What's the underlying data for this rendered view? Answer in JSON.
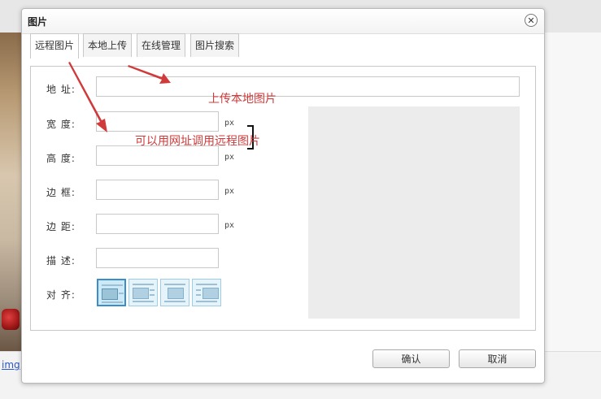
{
  "background": {
    "link_text": "img"
  },
  "dialog": {
    "title": "图片",
    "close_glyph": "✕",
    "tabs": [
      {
        "label": "远程图片",
        "active": true
      },
      {
        "label": "本地上传",
        "active": false
      },
      {
        "label": "在线管理",
        "active": false
      },
      {
        "label": "图片搜索",
        "active": false
      }
    ],
    "fields": {
      "address": {
        "label": "地 址:",
        "value": ""
      },
      "width": {
        "label": "宽 度:",
        "value": "",
        "unit": "px"
      },
      "height": {
        "label": "高 度:",
        "value": "",
        "unit": "px"
      },
      "border": {
        "label": "边 框:",
        "value": "",
        "unit": "px"
      },
      "margin": {
        "label": "边 距:",
        "value": "",
        "unit": "px"
      },
      "description": {
        "label": "描 述:",
        "value": ""
      },
      "align": {
        "label": "对 齐:",
        "options": [
          "none",
          "left",
          "center",
          "right"
        ],
        "selected": "none"
      }
    },
    "buttons": {
      "ok": "确认",
      "cancel": "取消"
    }
  },
  "annotations": {
    "upload_local": "上传本地图片",
    "remote_url": "可以用网址调用远程图片",
    "color": "#d03a3a"
  },
  "icons": {
    "close": "close-icon",
    "lock": "lock-bracket-icon",
    "align_none": "align-none-icon",
    "align_left": "align-left-icon",
    "align_center": "align-center-icon",
    "align_right": "align-right-icon"
  }
}
